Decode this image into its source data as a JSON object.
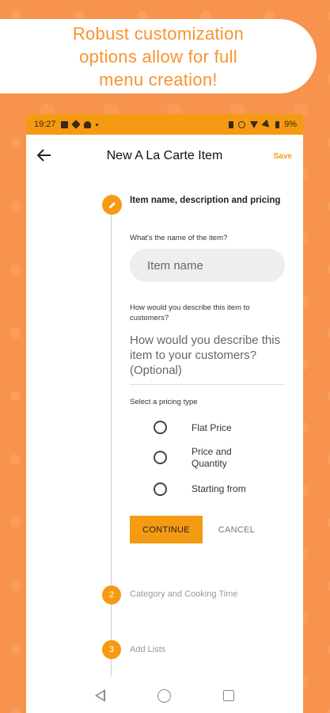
{
  "banner": {
    "line1": "Robust customization",
    "line2": "options allow for full",
    "line3": "menu creation!"
  },
  "statusbar": {
    "time": "19:27",
    "battery": "9%"
  },
  "appbar": {
    "title": "New A La Carte Item",
    "save_label": "Save"
  },
  "step1": {
    "title": "Item name, description and pricing",
    "name_label": "What's the name of the item?",
    "name_placeholder": "Item name",
    "desc_label": "How would you describe this item to customers?",
    "desc_placeholder": "How would you describe this item to your customers? (Optional)",
    "pricing_label": "Select a pricing type",
    "pricing_options": [
      "Flat Price",
      "Price and Quantity",
      "Starting from"
    ],
    "continue_label": "CONTINUE",
    "cancel_label": "CANCEL"
  },
  "step2": {
    "number": "2",
    "title": "Category and Cooking Time"
  },
  "step3": {
    "number": "3",
    "title": "Add Lists"
  },
  "colors": {
    "accent": "#F59A13",
    "background": "#F7934C",
    "banner_text": "#F7942E"
  }
}
